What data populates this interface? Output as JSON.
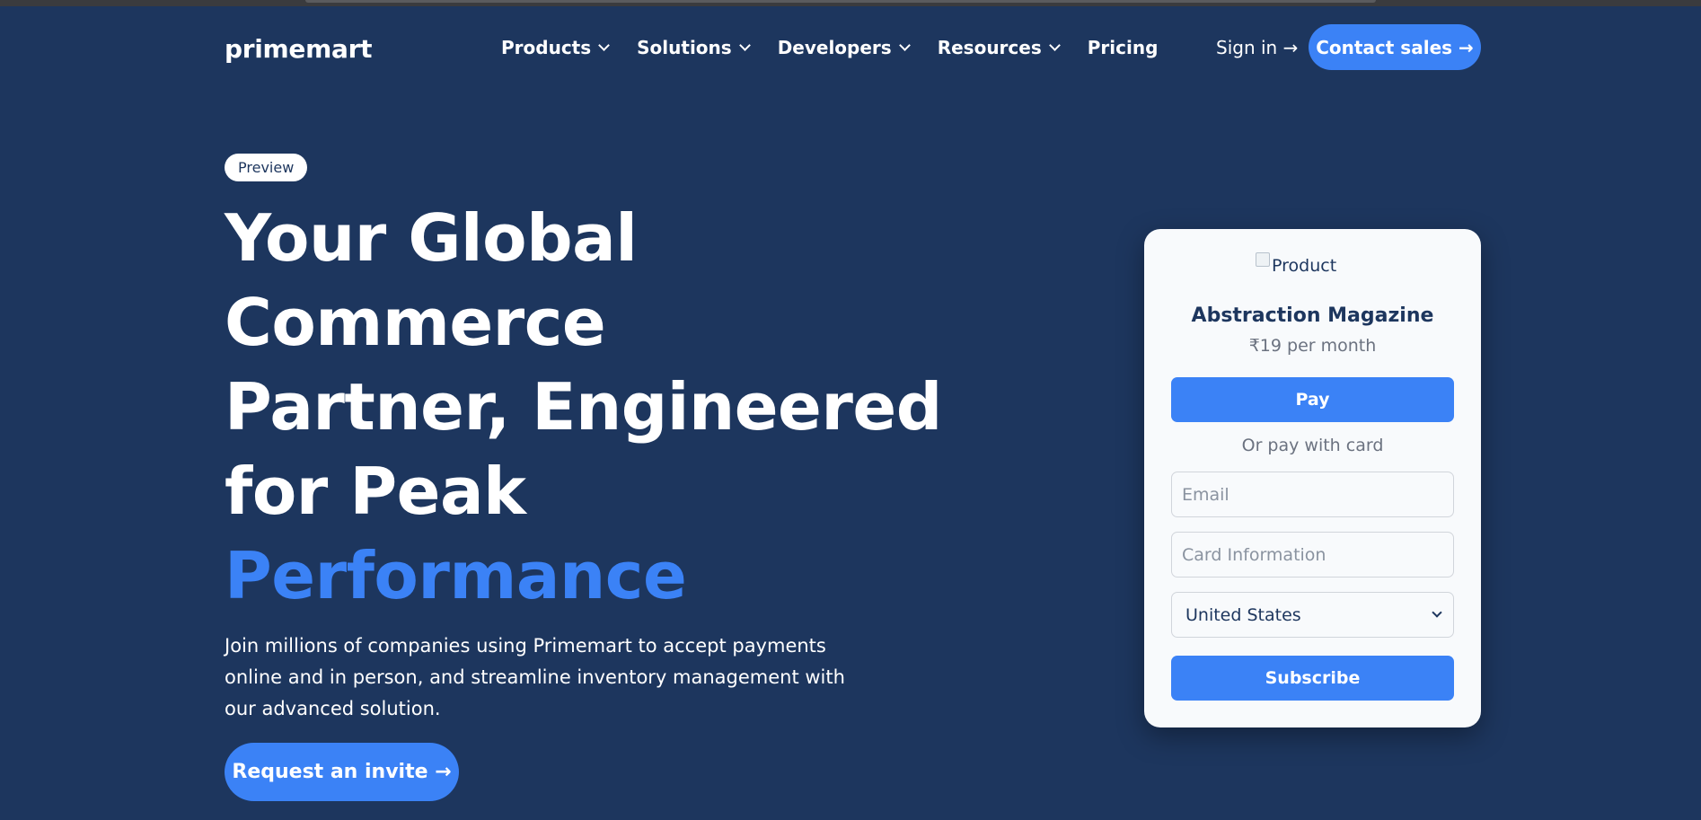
{
  "header": {
    "logo": "primemart",
    "nav": [
      {
        "label": "Products",
        "has_dropdown": true
      },
      {
        "label": "Solutions",
        "has_dropdown": true
      },
      {
        "label": "Developers",
        "has_dropdown": true
      },
      {
        "label": "Resources",
        "has_dropdown": true
      },
      {
        "label": "Pricing",
        "has_dropdown": false
      }
    ],
    "signin_label": "Sign in →",
    "contact_label": "Contact sales →"
  },
  "hero": {
    "badge": "Preview",
    "headline_lines": [
      "Your Global",
      "Commerce",
      "Partner, Engineered",
      "for Peak"
    ],
    "headline_accent": "Performance",
    "subtext": "Join millions of companies using Primemart to accept payments online and in person, and streamline inventory management with our advanced solution.",
    "cta_label": "Request an invite →"
  },
  "checkout": {
    "image_alt": "Product",
    "product_name": "Abstraction Magazine",
    "price": "₹19 per month",
    "pay_label": "Pay",
    "divider_text": "Or pay with card",
    "email_placeholder": "Email",
    "card_placeholder": "Card Information",
    "country_selected": "United States",
    "subscribe_label": "Subscribe"
  },
  "colors": {
    "background": "#1d365e",
    "accent": "#3b82f6",
    "card_background": "#f8fafc"
  }
}
